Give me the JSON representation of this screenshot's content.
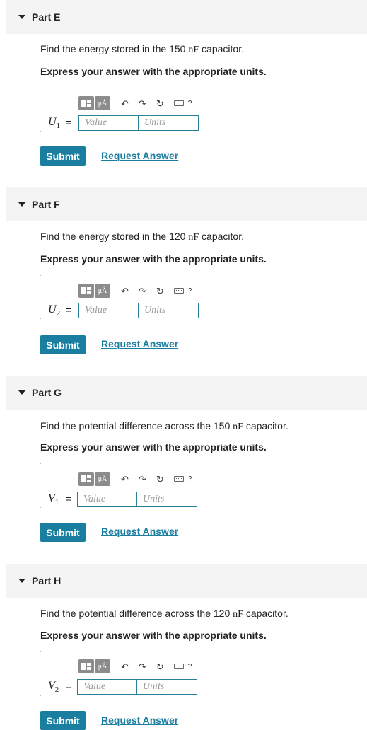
{
  "common": {
    "instruction": "Express your answer with the appropriate units.",
    "value_placeholder": "Value",
    "units_placeholder": "Units",
    "submit_label": "Submit",
    "request_answer_label": "Request Answer",
    "equals": "=",
    "toolbar": {
      "mu_label": "μÅ",
      "undo_icon": "undo-icon",
      "redo_icon": "redo-icon",
      "reset_icon": "reset-icon",
      "keyboard_icon": "keyboard-icon",
      "help_label": "?"
    }
  },
  "parts": [
    {
      "title": "Part E",
      "question_pre": "Find the energy stored in the 150 ",
      "question_unit": "nF",
      "question_post": " capacitor.",
      "var_letter": "U",
      "var_sub": "1"
    },
    {
      "title": "Part F",
      "question_pre": "Find the energy stored in the 120 ",
      "question_unit": "nF",
      "question_post": " capacitor.",
      "var_letter": "U",
      "var_sub": "2"
    },
    {
      "title": "Part G",
      "question_pre": "Find the potential difference across the 150 ",
      "question_unit": "nF",
      "question_post": " capacitor.",
      "var_letter": "V",
      "var_sub": "1"
    },
    {
      "title": "Part H",
      "question_pre": "Find the potential difference across the 120 ",
      "question_unit": "nF",
      "question_post": " capacitor.",
      "var_letter": "V",
      "var_sub": "2"
    }
  ],
  "colors": {
    "accent": "#1a7ea0",
    "header_bg": "#f4f4f4",
    "toolbar_button": "#8c8c8c"
  }
}
